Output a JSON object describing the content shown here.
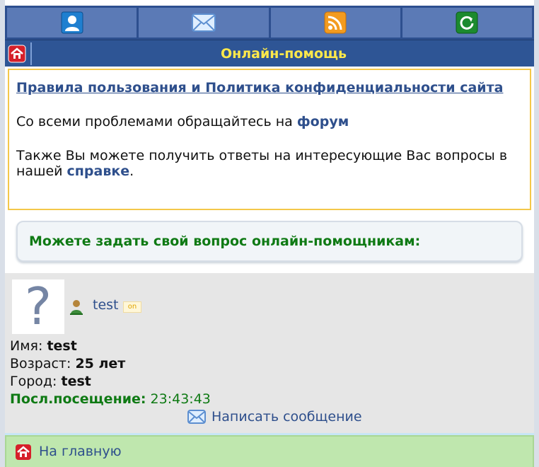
{
  "nav": {
    "items": [
      {
        "icon": "profile-icon"
      },
      {
        "icon": "mail-icon"
      },
      {
        "icon": "rss-icon"
      },
      {
        "icon": "refresh-icon"
      }
    ]
  },
  "header": {
    "title": "Онлайн-помощь",
    "home_icon": "home-icon"
  },
  "info": {
    "rules_link": "Правила пользования и Политика конфиденциальности сайта",
    "forum_text": "Со всеми проблемами обращайтесь на",
    "forum_link": "форум",
    "help_text": "Также Вы можете получить ответы на интересующие Вас вопросы в нашей",
    "help_link": "справке",
    "help_end": "."
  },
  "ask": {
    "text": "Можете задать свой вопрос онлайн-помощникам:"
  },
  "profile": {
    "avatar_placeholder": "?",
    "username": "test",
    "status_badge": "on",
    "name_label": "Имя:",
    "name_value": "test",
    "age_label": "Возраст:",
    "age_value": "25 лет",
    "city_label": "Город:",
    "city_value": "test",
    "last_visit_label": "Посл.посещение:",
    "last_visit_value": "23:43:43",
    "message_label": "Написать сообщение"
  },
  "footer": {
    "home_label": "На главную"
  },
  "colors": {
    "nav_bg": "#2d4f8f",
    "nav_button": "#5b7ab6",
    "title_text": "#ffe94a",
    "link": "#2e4f8c",
    "green": "#0f7a14",
    "footer_bg": "#bfe7ae"
  }
}
